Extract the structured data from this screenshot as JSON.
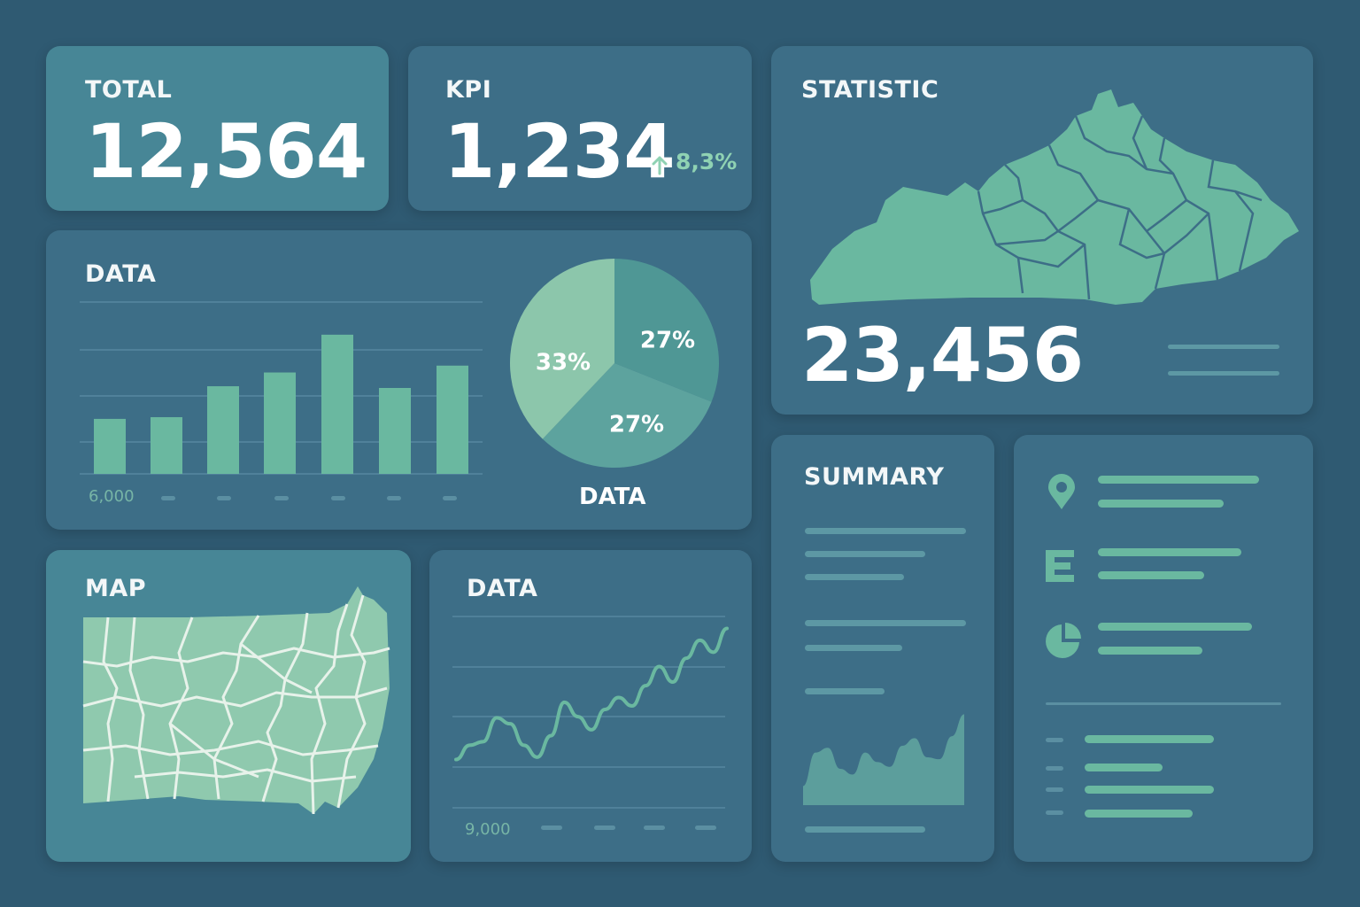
{
  "cards": {
    "total": {
      "title": "TOTAL",
      "value": "12,564"
    },
    "kpi": {
      "title": "KPI",
      "value": "1,234",
      "delta": "8,3%",
      "delta_icon": "arrow-up-icon"
    },
    "statistic": {
      "title": "STATISTIC",
      "value": "23,456"
    },
    "bar_data": {
      "title": "DATA",
      "x_tick_first": "6,000",
      "pie_caption": "DATA"
    },
    "map": {
      "title": "MAP"
    },
    "line_data": {
      "title": "DATA",
      "x_tick_first": "9,000"
    },
    "summary": {
      "title": "SUMMARY"
    },
    "info": {
      "icons": [
        "location-pin-icon",
        "letter-e-icon",
        "pie-chart-icon"
      ]
    }
  },
  "colors": {
    "background": "#2f5a72",
    "card": "#3d6e87",
    "card_teal": "#478696",
    "accent": "#6ab8a0",
    "accent_light": "#8fc9ae"
  },
  "chart_data": [
    {
      "type": "bar",
      "title": "DATA",
      "categories": [
        "",
        "",
        "",
        "",
        "",
        "",
        ""
      ],
      "values": [
        32,
        33,
        51,
        59,
        81,
        50,
        63
      ],
      "ylim": [
        0,
        100
      ],
      "x_ticks": [
        "6,000",
        "",
        "",
        "",
        "",
        "",
        ""
      ],
      "grid": true
    },
    {
      "type": "pie",
      "title": "DATA",
      "labels": [
        "27%",
        "27%",
        "33%"
      ],
      "values": [
        27,
        27,
        33
      ]
    },
    {
      "type": "line",
      "title": "DATA",
      "x": [
        0,
        1,
        2,
        3,
        4,
        5,
        6,
        7,
        8,
        9,
        10,
        11,
        12,
        13,
        14,
        15,
        16,
        17,
        18,
        19,
        20
      ],
      "values": [
        10,
        22,
        25,
        45,
        40,
        22,
        12,
        30,
        58,
        46,
        35,
        52,
        62,
        55,
        72,
        88,
        75,
        95,
        110,
        100,
        120
      ],
      "ylim": [
        0,
        130
      ],
      "x_ticks": [
        "9,000",
        "",
        "",
        "",
        ""
      ],
      "grid": true
    },
    {
      "type": "area",
      "values": [
        20,
        55,
        60,
        38,
        32,
        55,
        45,
        40,
        62,
        70,
        50,
        48,
        72,
        95
      ],
      "ylim": [
        0,
        100
      ]
    }
  ]
}
